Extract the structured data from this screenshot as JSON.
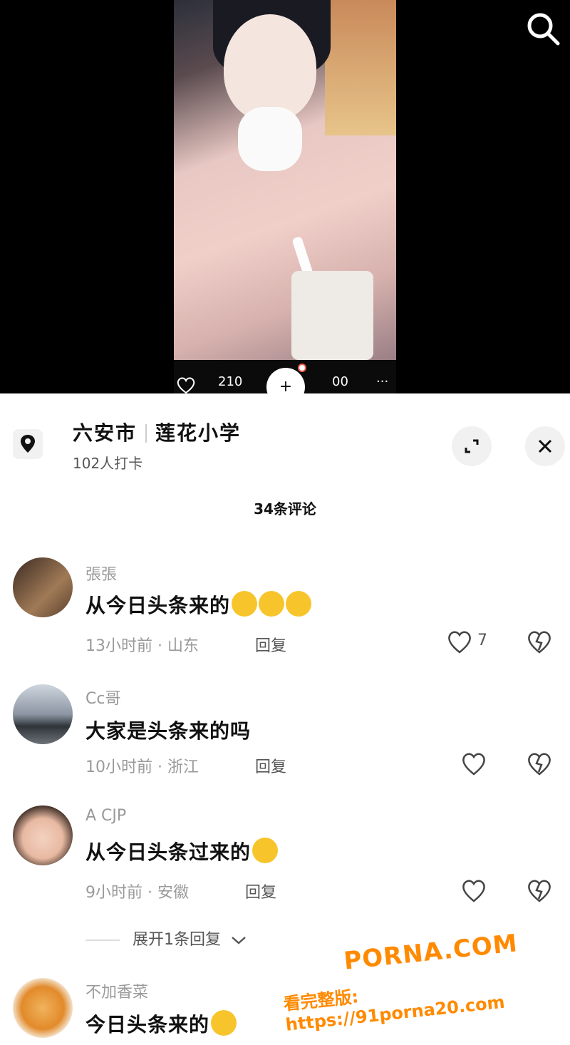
{
  "video": {
    "likes": "210",
    "comments": "00",
    "more": "···",
    "plus": "+"
  },
  "location": {
    "city": "六安市",
    "place": "莲花小学",
    "checkins": "102人打卡"
  },
  "comments_header": "34条评论",
  "comments": [
    {
      "user": "張張",
      "text": "从今日头条来的",
      "emoji": [
        "laughing-crying",
        "laughing-crying",
        "laughing-crying"
      ],
      "time": "13小时前",
      "region": "山东",
      "reply": "回复",
      "likes": "7"
    },
    {
      "user": "Cc哥",
      "text": "大家是头条来的吗",
      "emoji": [],
      "time": "10小时前",
      "region": "浙江",
      "reply": "回复",
      "likes": ""
    },
    {
      "user": "A   CJP",
      "text": "从今日头条过来的",
      "emoji": [
        "grinning"
      ],
      "time": "9小时前",
      "region": "安徽",
      "reply": "回复",
      "likes": ""
    },
    {
      "user": "不加香菜",
      "text": "今日头条来的",
      "emoji": [
        "smirk"
      ],
      "time": "",
      "region": "",
      "reply": "",
      "likes": ""
    }
  ],
  "expand_replies": "展开1条回复",
  "watermark": {
    "brand": "PORNA.COM",
    "url": "看完整版: https://91porna20.com"
  },
  "colors": {
    "accent": "#ff8a00",
    "muted": "#9a9a9a"
  }
}
